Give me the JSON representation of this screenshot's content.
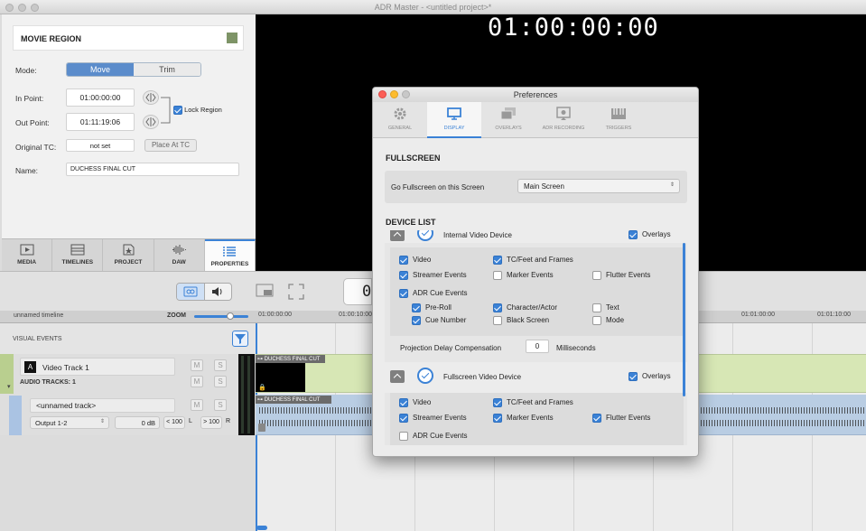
{
  "window": {
    "title": "ADR Master - <untitled project>*"
  },
  "video": {
    "timecode": "01:00:00:00"
  },
  "properties": {
    "header": "MOVIE REGION",
    "swatch_color": "#7e9467",
    "mode_label": "Mode:",
    "mode_options": [
      "Move",
      "Trim"
    ],
    "in_point_label": "In Point:",
    "in_point_value": "01:00:00:00",
    "out_point_label": "Out Point:",
    "out_point_value": "01:11:19:06",
    "lock_region_label": "Lock Region",
    "original_tc_label": "Original TC:",
    "original_tc_value": "not set",
    "place_at_tc_label": "Place At TC",
    "name_label": "Name:",
    "name_value": "DUCHESS FINAL CUT"
  },
  "tabs": [
    "MEDIA",
    "TIMELINES",
    "PROJECT",
    "DAW",
    "PROPERTIES"
  ],
  "timeline": {
    "name": "unnamed timeline",
    "zoom_label": "ZOOM",
    "ruler_ticks": [
      "01:00:00:00",
      "01:00:10:00",
      "01:01:00:00",
      "01:01:10:00"
    ],
    "visual_events_label": "VISUAL EVENTS",
    "video_track_letter": "A",
    "video_track_name": "Video Track 1",
    "audio_tracks_label": "AUDIO TRACKS: 1",
    "audio_track_name": "<unnamed track>",
    "output_value": "Output 1-2",
    "gain_value": "0 dB",
    "pan_left": "< 100",
    "pan_left_ch": "L",
    "pan_right": "> 100",
    "pan_right_ch": "R",
    "clip_name": "DUCHESS FINAL CUT",
    "mute": "M",
    "solo": "S",
    "counter_partial": "0"
  },
  "preferences": {
    "title": "Preferences",
    "tabs": [
      "GENERAL",
      "DISPLAY",
      "OVERLAYS",
      "ADR RECORDING",
      "TRIGGERS"
    ],
    "fullscreen_header": "FULLSCREEN",
    "go_fullscreen_label": "Go Fullscreen on this Screen",
    "screen_select_value": "Main Screen",
    "device_list_header": "DEVICE LIST",
    "device1": {
      "name": "Internal Video Device",
      "overlays": "Overlays",
      "checks": [
        {
          "label": "Video",
          "on": true
        },
        {
          "label": "TC/Feet and Frames",
          "on": true
        },
        {
          "label": "Streamer Events",
          "on": true
        },
        {
          "label": "Marker Events",
          "on": false
        },
        {
          "label": "Flutter Events",
          "on": false
        },
        {
          "label": "ADR Cue Events",
          "on": true
        },
        {
          "label": "Pre-Roll",
          "on": true
        },
        {
          "label": "Character/Actor",
          "on": true
        },
        {
          "label": "Text",
          "on": false
        },
        {
          "label": "Cue Number",
          "on": true
        },
        {
          "label": "Black Screen",
          "on": false
        },
        {
          "label": "Mode",
          "on": false
        }
      ],
      "delay_label": "Projection Delay Compensation",
      "delay_value": "0",
      "delay_unit": "Milliseconds"
    },
    "device2": {
      "name": "Fullscreen Video Device",
      "overlays": "Overlays",
      "checks": [
        {
          "label": "Video",
          "on": true
        },
        {
          "label": "TC/Feet and Frames",
          "on": true
        },
        {
          "label": "Streamer Events",
          "on": true
        },
        {
          "label": "Marker Events",
          "on": true
        },
        {
          "label": "Flutter Events",
          "on": true
        },
        {
          "label": "ADR Cue Events",
          "on": false
        }
      ]
    }
  }
}
